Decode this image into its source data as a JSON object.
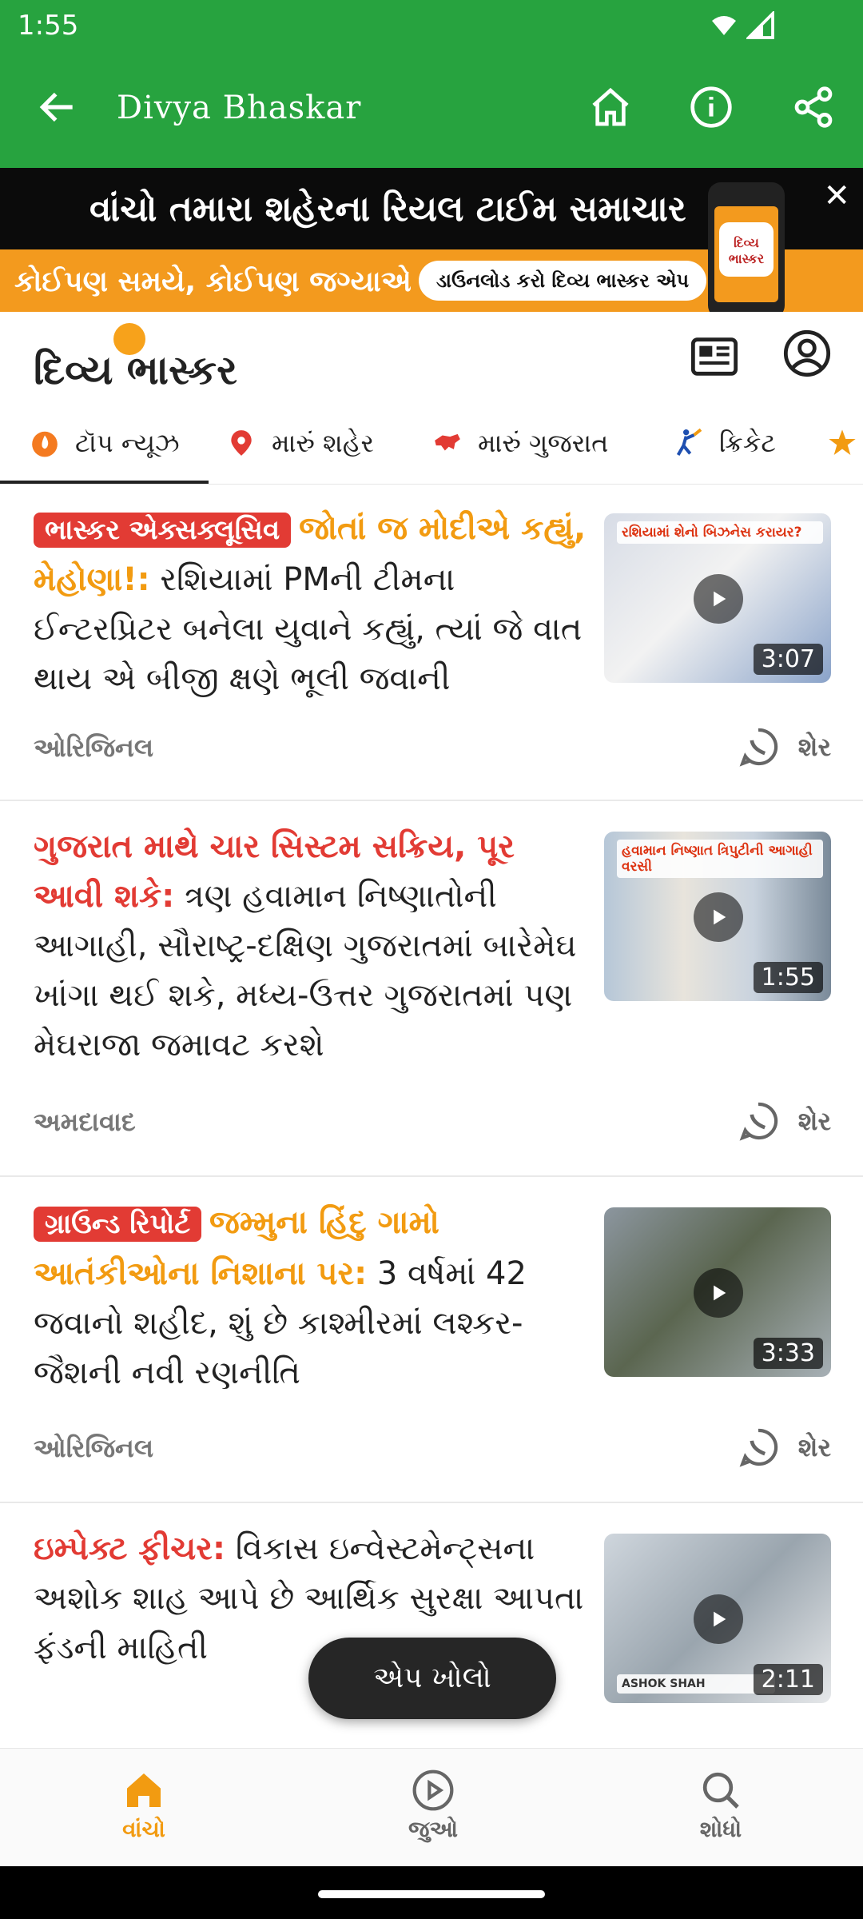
{
  "status_bar": {
    "time": "1:55"
  },
  "app_bar": {
    "title": "Divya Bhaskar"
  },
  "banner": {
    "line1": "વાંચો તમારા શહેરના રિયલ ટાઈમ સમાચાર",
    "line2": "કોઈપણ સમયે, કોઈપણ જગ્યાએ",
    "cta": "ડાઉનલોડ કરો દિવ્ય ભાસ્કર એપ",
    "logo": "દિવ્ય ભાસ્કર"
  },
  "brand": {
    "name": "દિવ્ય ભાસ્કર"
  },
  "tabs": [
    {
      "label": "ટૉપ ન્યૂઝ",
      "icon": "flame-icon"
    },
    {
      "label": "મારું શહેર",
      "icon": "location-pin-icon"
    },
    {
      "label": "મારું ગુજરાત",
      "icon": "gujarat-map-icon"
    },
    {
      "label": "ક્રિકેટ",
      "icon": "cricket-icon"
    }
  ],
  "articles": [
    {
      "badge": "ભાસ્કર એક્સક્લૂસિવ",
      "kicker": "જોતાં જ મોદીએ કહ્યું, મેહોણા!:",
      "title": "રશિયામાં PMની ટીમના ઈન્ટરપ્રિટર બનેલા યુવાને કહ્યું, ત્યાં જે વાત થાય એ બીજી ક્ષણે ભૂલી જવાની",
      "meta": "ઓરિજિનલ",
      "share": "શેર",
      "duration": "3:07",
      "thumb_caption": "રશિયામાં શેનો બિઝનેસ કરાયર?"
    },
    {
      "kicker": "ગુજરાત માથે ચાર સિસ્ટમ સક્રિય, પૂર આવી શકે:",
      "title": "ત્રણ હવામાન નિષ્ણાતોની આગાહી, સૌરાષ્ટ્ર-દક્ષિણ ગુજરાતમાં બારેમેઘ ખાંગા થઈ શકે, મધ્ય-ઉત્તર ગુજરાતમાં પણ મેઘરાજા જમાવટ કરશે",
      "meta": "અમદાવાદ",
      "share": "શેર",
      "duration": "1:55",
      "thumb_caption": "હવામાન નિષ્ણાત ત્રિપુટીની આગાહી વરસી"
    },
    {
      "badge": "ગ્રાઉન્ડ રિપોર્ટ",
      "kicker": "જમ્મુના હિંદુ ગામો આતંકીઓના નિશાના પર:",
      "title": "3 વર્ષમાં 42 જવાનો શહીદ, શું છે કાશ્મીરમાં લશ્કર-જૈશની નવી રણનીતિ",
      "meta": "ઓરિજિનલ",
      "share": "શેર",
      "duration": "3:33"
    },
    {
      "kicker": "ઇમ્પેક્ટ ફીચર:",
      "title": "વિકાસ ઇન્વેસ્ટમેન્ટ્સના અશોક શાહ આપે છે આર્થિક સુરક્ષા આપતા ફંડની માહિતી",
      "duration": "2:11",
      "thumb_caption": "ASHOK SHAH"
    }
  ],
  "open_app": "એપ ખોલો",
  "bottom_nav": [
    {
      "label": "વાંચો",
      "icon": "home-icon"
    },
    {
      "label": "જુઓ",
      "icon": "play-circle-icon"
    },
    {
      "label": "શોધો",
      "icon": "search-icon"
    }
  ],
  "colors": {
    "app_bar": "#27a33f",
    "accent": "#f29b11",
    "badge": "#e23b34"
  }
}
